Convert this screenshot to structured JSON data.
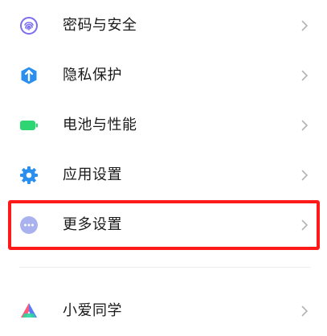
{
  "settings": {
    "items": [
      {
        "label": "密码与安全",
        "icon": "fingerprint-icon",
        "color": "#7b6cf0"
      },
      {
        "label": "隐私保护",
        "icon": "privacy-shield-icon",
        "color": "#2b8ff0"
      },
      {
        "label": "电池与性能",
        "icon": "battery-icon",
        "color": "#2ed573"
      },
      {
        "label": "应用设置",
        "icon": "gear-icon",
        "color": "#2b8ff0"
      },
      {
        "label": "更多设置",
        "icon": "more-dots-icon",
        "color": "#8e9be8"
      },
      {
        "label": "小爱同学",
        "icon": "xiaoai-icon",
        "color": "#5a7cf6"
      }
    ],
    "highlighted_item": "更多设置",
    "highlight_color": "#ff1a1a",
    "chevron_icon": "chevron-right-icon"
  }
}
